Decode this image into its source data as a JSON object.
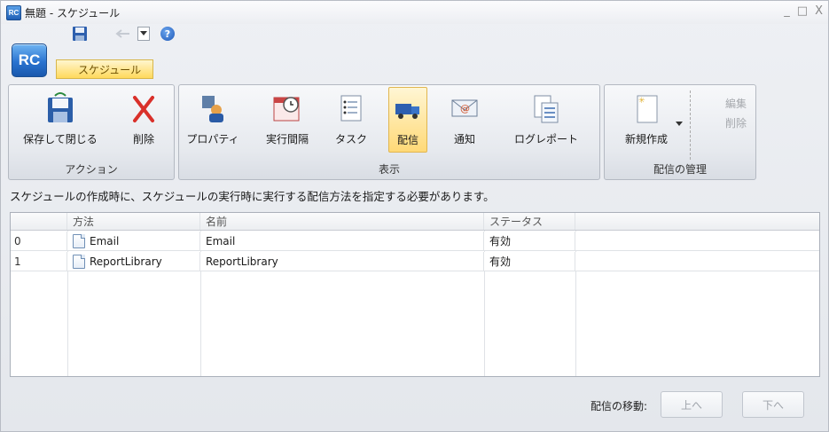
{
  "window": {
    "app_badge": "RC",
    "title": "無題 - スケジュール",
    "controls": {
      "minimize": "_",
      "maximize": "□",
      "close": "X"
    }
  },
  "quick_access": {
    "orb_label": "RC",
    "help_label": "?",
    "tab_label": "スケジュール"
  },
  "ribbon": {
    "groups": {
      "action": {
        "label": "アクション"
      },
      "view": {
        "label": "表示"
      },
      "manage": {
        "label": "配信の管理"
      }
    },
    "buttons": {
      "save_close": "保存して閉じる",
      "delete": "削除",
      "properties": "プロパティ",
      "interval": "実行間隔",
      "task": "タスク",
      "delivery": "配信",
      "notify": "通知",
      "log_report": "ログレポート",
      "new": "新規作成",
      "edit": "編集",
      "remove": "削除"
    }
  },
  "description": "スケジュールの作成時に、スケジュールの実行時に実行する配信方法を指定する必要があります。",
  "table": {
    "headers": {
      "method": "方法",
      "name": "名前",
      "status": "ステータス"
    },
    "rows": [
      {
        "index": "0",
        "method": "Email",
        "name": "Email",
        "status": "有効"
      },
      {
        "index": "1",
        "method": "ReportLibrary",
        "name": "ReportLibrary",
        "status": "有効"
      }
    ]
  },
  "bottom": {
    "move_label": "配信の移動:",
    "up_label": "上へ",
    "down_label": "下へ"
  },
  "colors": {
    "accent_active": "#ffd977",
    "orb_blue": "#2a73d0",
    "delete_red": "#d9302a"
  }
}
